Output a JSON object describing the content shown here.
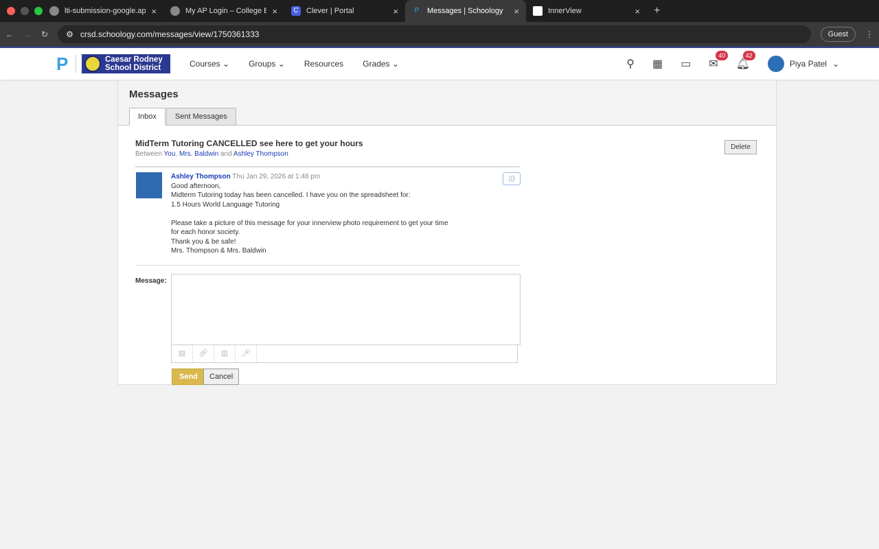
{
  "browser": {
    "tabs": [
      {
        "label": "lti-submission-google.app.sc",
        "icon": "globe"
      },
      {
        "label": "My AP Login – College Board",
        "icon": "globe"
      },
      {
        "label": "Clever | Portal",
        "icon": "C"
      },
      {
        "label": "Messages | Schoology",
        "icon": "P"
      },
      {
        "label": "InnerView",
        "icon": "iv"
      }
    ],
    "url": "crsd.schoology.com/messages/view/1750361333",
    "guest": "Guest"
  },
  "nav": {
    "district_line1": "Caesar Rodney",
    "district_line2": "School District",
    "items": [
      "Courses",
      "Groups",
      "Resources",
      "Grades"
    ],
    "mail_count": "40",
    "notif_count": "42",
    "user": "Piya Patel"
  },
  "page": {
    "title": "Messages",
    "tabs": [
      "Inbox",
      "Sent Messages"
    ],
    "subject": "MidTerm Tutoring CANCELLED see here to get your hours",
    "between_label": "Between",
    "p1": "You",
    "p2": "Mrs. Baldwin",
    "and": "and",
    "p3": "Ashley Thompson",
    "delete": "Delete"
  },
  "post": {
    "author": "Ashley Thompson",
    "date": "Thu Jan 29, 2026 at 1:48 pm",
    "lines": [
      "Good afternoon,",
      "Midterm Tutoring today has been cancelled. I have you on the spreadsheet for:",
      "1.5 Hours World Language Tutoring",
      "",
      "Please take a picture of this message for your innerview photo requirement to get your time",
      "for each honor society.",
      "Thank you & be safe!",
      "Mrs. Thompson & Mrs. Baldwin"
    ]
  },
  "reply": {
    "label": "Message:",
    "value": "",
    "send": "Send",
    "cancel": "Cancel"
  }
}
